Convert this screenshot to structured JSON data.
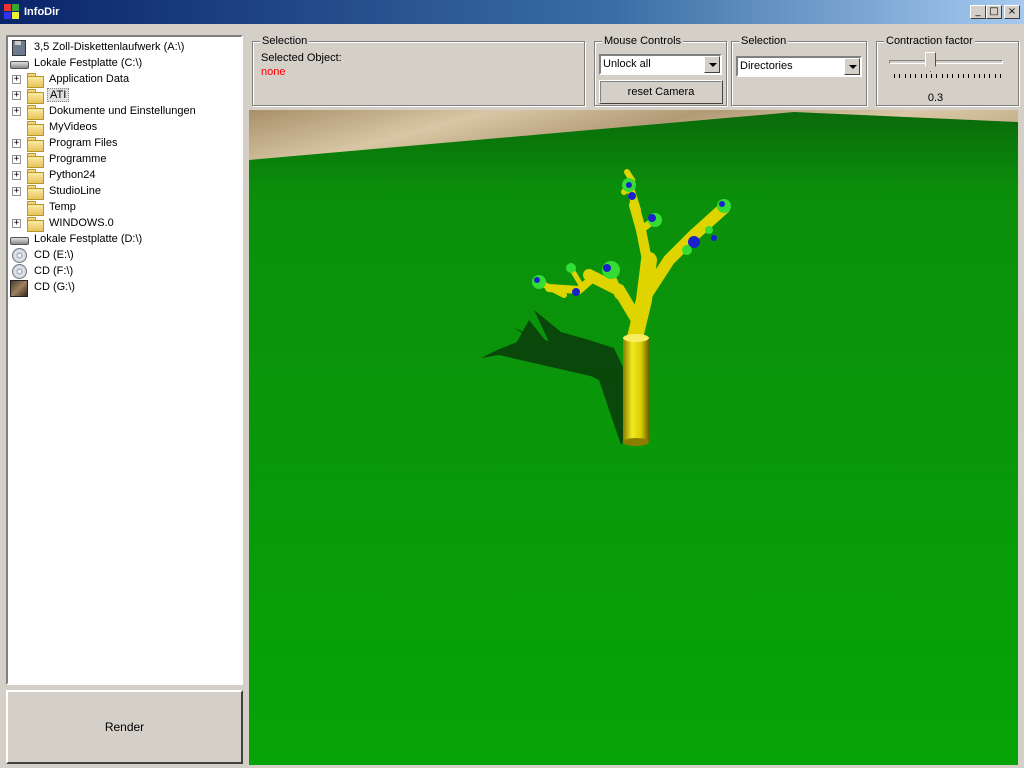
{
  "window": {
    "title": "InfoDir",
    "controls": {
      "minimize": "_",
      "maximize": "□",
      "close": "×"
    }
  },
  "tree": {
    "items": [
      {
        "label": "3,5 Zoll-Diskettenlaufwerk (A:\\)",
        "type": "floppy",
        "level": 0,
        "expander": false
      },
      {
        "label": "Lokale Festplatte (C:\\)",
        "type": "hdd",
        "level": 0,
        "expander": false
      },
      {
        "label": "Application Data",
        "type": "folder",
        "level": 1,
        "expander": true
      },
      {
        "label": "ATI",
        "type": "folder",
        "level": 1,
        "expander": true,
        "selected": true
      },
      {
        "label": "Dokumente und Einstellungen",
        "type": "folder",
        "level": 1,
        "expander": true
      },
      {
        "label": "MyVideos",
        "type": "folder",
        "level": 1,
        "expander": false
      },
      {
        "label": "Program Files",
        "type": "folder",
        "level": 1,
        "expander": true
      },
      {
        "label": "Programme",
        "type": "folder",
        "level": 1,
        "expander": true
      },
      {
        "label": "Python24",
        "type": "folder",
        "level": 1,
        "expander": true
      },
      {
        "label": "StudioLine",
        "type": "folder",
        "level": 1,
        "expander": true
      },
      {
        "label": "Temp",
        "type": "folder",
        "level": 1,
        "expander": false
      },
      {
        "label": "WINDOWS.0",
        "type": "folder",
        "level": 1,
        "expander": true
      },
      {
        "label": "Lokale Festplatte (D:\\)",
        "type": "hdd",
        "level": 0,
        "expander": false
      },
      {
        "label": "CD (E:\\)",
        "type": "cd",
        "level": 0,
        "expander": false
      },
      {
        "label": "CD (F:\\)",
        "type": "cd",
        "level": 0,
        "expander": false
      },
      {
        "label": "CD (G:\\)",
        "type": "cdimg",
        "level": 0,
        "expander": false
      }
    ],
    "expander_symbol": "+"
  },
  "render_button": {
    "label": "Render"
  },
  "selection_panel": {
    "title": "Selection",
    "selected_label": "Selected Object:",
    "selected_value": "none",
    "selected_value_color": "#ff0000"
  },
  "mouse_controls": {
    "title": "Mouse Controls",
    "combo_value": "Unlock all",
    "reset_button": "reset Camera"
  },
  "selection_filter": {
    "title": "Selection",
    "combo_value": "Directories"
  },
  "contraction": {
    "title": "Contraction factor",
    "value": "0.3",
    "slider_fraction": 0.3
  },
  "viewport": {
    "ground_color": "#0a9a0a",
    "tree_color": "#e6d800",
    "node_color": "#33dd33",
    "node_accent": "#1a22cc"
  }
}
